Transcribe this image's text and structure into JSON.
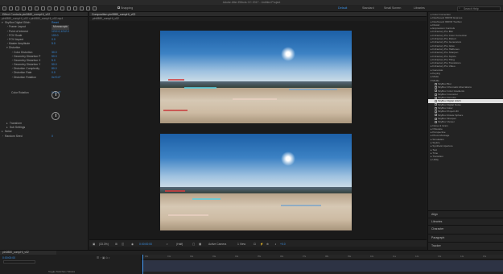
{
  "window": {
    "title": "Adobe After Effects CC 2017 - Untitled Project"
  },
  "toolbar": {
    "snapping_label": "Snapping",
    "workspaces": [
      "Default",
      "Standard",
      "Small Screen",
      "Libraries"
    ],
    "active_workspace": "Default",
    "search_placeholder": "Search Help"
  },
  "effect_controls": {
    "tab_label": "Effect Controls pin0880_compHi_v02",
    "layer_path": "pin0880_compHi_v02 • pin0880_compHi_v02.mp4",
    "effect_name": "SkyBox Digital Glitch",
    "reset_label": "Reset",
    "mode_value": "Monoscopic",
    "rows": [
      {
        "label": "Frame Layout",
        "value": "Monoscopic"
      },
      {
        "label": "Point of Interest",
        "value": "1212.0,1212.0"
      },
      {
        "label": "FOV Scale",
        "value": "100.0"
      },
      {
        "label": "FOV Aspect",
        "value": "0.0"
      },
      {
        "label": "Master Amplitude",
        "value": "5.0"
      },
      {
        "label": "Distortion",
        "value": ""
      },
      {
        "label": "Color Distortion",
        "value": "30.0"
      },
      {
        "label": "Geometry Distortion P",
        "value": "50.0"
      },
      {
        "label": "Geometry Distortion X",
        "value": "5.0"
      },
      {
        "label": "Geometry Distortion Y",
        "value": "50.0"
      },
      {
        "label": "Distortion Complexity",
        "value": "80.0"
      },
      {
        "label": "Distortion Rate",
        "value": "0.0"
      },
      {
        "label": "Distortion Rotation",
        "value": "0x+0.0°"
      }
    ],
    "color_rotation_label": "Color Rotation",
    "color_rotation_value": "0x+0.0°",
    "footer_rows": [
      "Transform",
      "Sub Settings",
      "Noise",
      "Random Seed"
    ],
    "random_seed_value": "0"
  },
  "composition": {
    "tab_label": "Composition pin0880_compHi_v02",
    "sub_tab": "pin0880_compHi_v02",
    "zoom": "(33.3%)",
    "timecode": "0:00:00:00",
    "resolution": "(Half)",
    "camera": "Active Camera",
    "view": "1 View",
    "exposure": "+0.0"
  },
  "effects_presets": {
    "items": [
      {
        "label": "Color Correction",
        "level": 0
      },
      {
        "label": "Dashwood 360VR Express",
        "level": 0
      },
      {
        "label": "Dashwood 360VR Toolbox",
        "level": 0
      },
      {
        "label": "Distort",
        "level": 0
      },
      {
        "label": "Expression Controls",
        "level": 0
      },
      {
        "label": "FxFactory Pro Blur",
        "level": 0
      },
      {
        "label": "FxFactory Pro Color Correction",
        "level": 0
      },
      {
        "label": "FxFactory Pro Distort",
        "level": 0
      },
      {
        "label": "FxFactory Pro Generators",
        "level": 0
      },
      {
        "label": "FxFactory Pro Glow",
        "level": 0
      },
      {
        "label": "FxFactory Pro Halftones",
        "level": 0
      },
      {
        "label": "FxFactory Pro Sharpen",
        "level": 0
      },
      {
        "label": "FxFactory Pro Stylize",
        "level": 0
      },
      {
        "label": "FxFactory Pro Tiling",
        "level": 0
      },
      {
        "label": "FxFactory Pro Transitions",
        "level": 0
      },
      {
        "label": "FxFactory Pro Video",
        "level": 0
      },
      {
        "label": "Generate",
        "level": 0
      },
      {
        "label": "Keying",
        "level": 0
      },
      {
        "label": "Matte",
        "level": 0
      },
      {
        "label": "Mettle",
        "level": 0
      },
      {
        "label": "SkyBox Blur",
        "level": 1
      },
      {
        "label": "SkyBox Chromatic Aberrations",
        "level": 1
      },
      {
        "label": "SkyBox Color Gradients",
        "level": 1
      },
      {
        "label": "SkyBox Converter",
        "level": 1
      },
      {
        "label": "SkyBox Denoise",
        "level": 1
      },
      {
        "label": "SkyBox Digital Glitch",
        "level": 1,
        "selected": true
      },
      {
        "label": "SkyBox Digital Noise",
        "level": 1
      },
      {
        "label": "SkyBox Glow",
        "level": 1
      },
      {
        "label": "SkyBox Project 2D",
        "level": 1
      },
      {
        "label": "SkyBox Rotate Sphere",
        "level": 1
      },
      {
        "label": "SkyBox Sharpen",
        "level": 1
      },
      {
        "label": "SkyBox Viewer",
        "level": 1
      },
      {
        "label": "Noise & Grain",
        "level": 0
      },
      {
        "label": "Obsolete",
        "level": 0
      },
      {
        "label": "Perspective",
        "level": 0
      },
      {
        "label": "Photo Montage",
        "level": 0
      },
      {
        "label": "Simulation",
        "level": 0
      },
      {
        "label": "Stylize",
        "level": 0
      },
      {
        "label": "Synthetic Aperture",
        "level": 0
      },
      {
        "label": "Text",
        "level": 0
      },
      {
        "label": "Time",
        "level": 0
      },
      {
        "label": "Transition",
        "level": 0
      },
      {
        "label": "Utility",
        "level": 0
      }
    ],
    "sections": [
      "Align",
      "Libraries",
      "Character",
      "Paragraph",
      "Tracker"
    ]
  },
  "timeline": {
    "tab_label": "pin0880_compHi_v02",
    "timecode": "0:00:00:00",
    "toggle_label": "Toggle Switches / Modes",
    "ruler_ticks": [
      "00s",
      "01s",
      "02s",
      "03s",
      "04s",
      "05s",
      "06s",
      "07s",
      "08s",
      "09s",
      "10s",
      "11s",
      "12s",
      "13s",
      "14s",
      "15s"
    ]
  }
}
